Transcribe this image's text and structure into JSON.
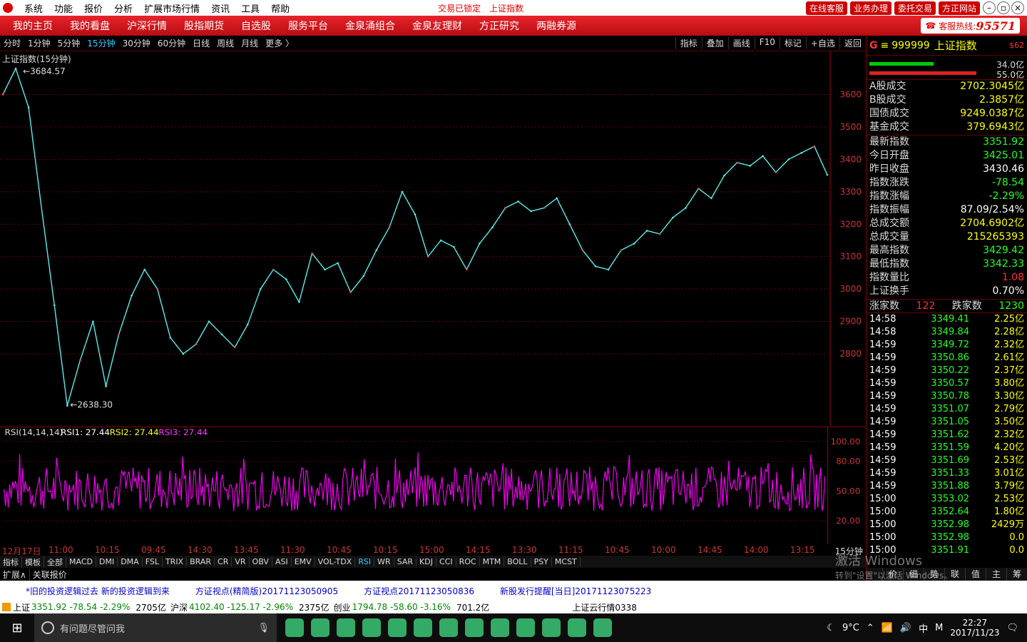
{
  "menu": [
    "系统",
    "功能",
    "报价",
    "分析",
    "扩展市场行情",
    "资讯",
    "工具",
    "帮助"
  ],
  "menu_status": [
    "交易已锁定",
    "上证指数"
  ],
  "menu_buttons": [
    "在线客服",
    "业务办理",
    "委托交易",
    "方正网站"
  ],
  "nav": [
    "我的主页",
    "我的看盘",
    "沪深行情",
    "股指期货",
    "自选股",
    "服务平台",
    "金泉涌组合",
    "金泉友理财",
    "方正研究",
    "两融券源"
  ],
  "hotline": {
    "label": "客服热线:",
    "number": "95571"
  },
  "periods": [
    "分时",
    "1分钟",
    "5分钟",
    "15分钟",
    "30分钟",
    "60分钟",
    "日线",
    "周线",
    "月线",
    "更多 〉"
  ],
  "selected_period": "15分钟",
  "tools": [
    "指标",
    "叠加",
    "画线",
    "F10",
    "标记",
    "+自选",
    "返回"
  ],
  "chart": {
    "title": "上证指数(15分钟)",
    "max_label": "3684.57",
    "min_label": "2638.30",
    "yticks": [
      3600,
      3500,
      3400,
      3300,
      3200,
      3100,
      3000,
      2900,
      2800
    ]
  },
  "rsi": {
    "label": "RSI(14,14,14)",
    "rsi1": "RSI1: 27.44",
    "rsi2": "RSI2: 27.44",
    "rsi3": "RSI3: 27.44",
    "yticks": [
      "100.00",
      "80.00",
      "50.00",
      "20.00"
    ]
  },
  "time_labels": [
    "12月17日",
    "11:00",
    "10:15",
    "09:45",
    "14:30",
    "13:45",
    "11:30",
    "10:45",
    "10:15",
    "15:00",
    "14:15",
    "13:30",
    "11:15",
    "10:45",
    "10:00",
    "14:45",
    "14:00",
    "13:15"
  ],
  "time_unit": "15分钟",
  "index_tabs": [
    "指标",
    "模板",
    "全部",
    "MACD",
    "DMI",
    "DMA",
    "FSL",
    "TRIX",
    "BRAR",
    "CR",
    "VR",
    "OBV",
    "ASI",
    "EMV",
    "VOL-TDX",
    "RSI",
    "WR",
    "SAR",
    "KDJ",
    "CCI",
    "ROC",
    "MTM",
    "BOLL",
    "PSY",
    "MCST"
  ],
  "ext": [
    "扩展∧",
    "关联报价"
  ],
  "quote": {
    "code": "999999",
    "name": "上证指数",
    "flag": "$62",
    "bar1": "34.0亿",
    "bar2": "55.0亿",
    "turnover": [
      [
        "A股成交",
        "2702.3045亿"
      ],
      [
        "B股成交",
        "2.3857亿"
      ],
      [
        "国债成交",
        "9249.0387亿"
      ],
      [
        "基金成交",
        "379.6943亿"
      ]
    ],
    "fields": [
      [
        "最新指数",
        "3351.92",
        "g"
      ],
      [
        "今日开盘",
        "3425.01",
        "g"
      ],
      [
        "昨日收盘",
        "3430.46",
        "w"
      ],
      [
        "指数涨跌",
        "-78.54",
        "g"
      ],
      [
        "指数涨幅",
        "-2.29%",
        "g"
      ],
      [
        "指数振幅",
        "87.09/2.54%",
        "w"
      ],
      [
        "总成交额",
        "2704.6902亿",
        "y"
      ],
      [
        "总成交量",
        "215265393",
        "y"
      ],
      [
        "最高指数",
        "3429.42",
        "g"
      ],
      [
        "最低指数",
        "3342.33",
        "g"
      ],
      [
        "指数量比",
        "1.08",
        "r"
      ],
      [
        "上证换手",
        "0.70%",
        "w"
      ]
    ],
    "up": "涨家数",
    "upn": "122",
    "down": "跌家数",
    "downn": "1230"
  },
  "ticks": [
    [
      "14:58",
      "3349.41",
      "2.25亿"
    ],
    [
      "14:58",
      "3349.84",
      "2.28亿"
    ],
    [
      "14:59",
      "3349.72",
      "2.32亿"
    ],
    [
      "14:59",
      "3350.86",
      "2.61亿"
    ],
    [
      "14:59",
      "3350.22",
      "2.37亿"
    ],
    [
      "14:59",
      "3350.57",
      "3.80亿"
    ],
    [
      "14:59",
      "3350.78",
      "3.30亿"
    ],
    [
      "14:59",
      "3351.07",
      "2.79亿"
    ],
    [
      "14:59",
      "3351.05",
      "3.50亿"
    ],
    [
      "14:59",
      "3351.62",
      "2.32亿"
    ],
    [
      "14:59",
      "3351.59",
      "4.20亿"
    ],
    [
      "14:59",
      "3351.69",
      "2.53亿"
    ],
    [
      "14:59",
      "3351.33",
      "3.01亿"
    ],
    [
      "14:59",
      "3351.88",
      "3.79亿"
    ],
    [
      "15:00",
      "3353.02",
      "2.53亿"
    ],
    [
      "15:00",
      "3352.64",
      "1.80亿"
    ],
    [
      "15:00",
      "3352.98",
      "2429万"
    ],
    [
      "15:00",
      "3352.98",
      "0.0"
    ],
    [
      "15:00",
      "3351.91",
      "0.0"
    ]
  ],
  "rp_tabs": [
    "价",
    "细",
    "势",
    "联",
    "值",
    "主",
    "筹"
  ],
  "news": [
    "*旧的投资逻辑过去 新的投资逻辑到来",
    "方证视点(精简版)20171123050905",
    "方证视点20171123050836",
    "新股发行提醒[当日]20171123075223"
  ],
  "status": [
    {
      "n": "上证",
      "v": "3351.92 -78.54 -2.29%",
      "a": "2705亿"
    },
    {
      "n": "沪深",
      "v": "4102.40 -125.17 -2.96%",
      "a": "2375亿"
    },
    {
      "n": "创业",
      "v": "1794.78 -58.60 -3.16%",
      "a": "701.2亿"
    }
  ],
  "status_right": "上证云行情0338",
  "activate": [
    "激活 Windows",
    "转到\"设置\"以激活 Windows。"
  ],
  "taskbar": {
    "search": "有问题尽管问我",
    "weather": "9°C",
    "ime": "中",
    "time": "22:27",
    "date": "2017/11/23"
  },
  "chart_data": {
    "type": "line",
    "title": "上证指数(15分钟)",
    "ylim": [
      2600,
      3700
    ],
    "high": 3684.57,
    "low": 2638.3,
    "values": [
      3600,
      3680,
      3560,
      3250,
      2950,
      2640,
      2780,
      2900,
      2700,
      2860,
      2980,
      3060,
      3000,
      2850,
      2800,
      2830,
      2900,
      2860,
      2820,
      2890,
      3000,
      3060,
      3030,
      2960,
      3110,
      3060,
      3080,
      2990,
      3040,
      3120,
      3190,
      3300,
      3230,
      3100,
      3150,
      3130,
      3060,
      3140,
      3190,
      3250,
      3270,
      3240,
      3250,
      3280,
      3200,
      3120,
      3070,
      3060,
      3120,
      3140,
      3180,
      3170,
      3220,
      3250,
      3310,
      3280,
      3350,
      3390,
      3380,
      3410,
      3360,
      3400,
      3420,
      3440,
      3352
    ]
  }
}
